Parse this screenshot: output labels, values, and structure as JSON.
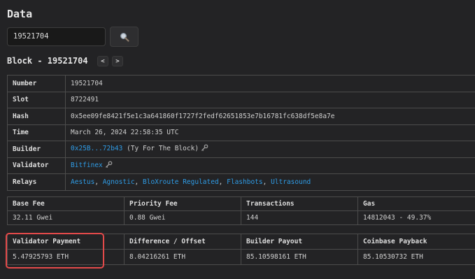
{
  "page": {
    "title": "Data"
  },
  "search": {
    "value": "19521704",
    "button_icon": "search-icon"
  },
  "block": {
    "heading": "Block - 19521704",
    "prev_label": "<",
    "next_label": ">"
  },
  "info": {
    "number_label": "Number",
    "number": "19521704",
    "slot_label": "Slot",
    "slot": "8722491",
    "hash_label": "Hash",
    "hash": "0x5ee09fe8421f5e1c3a641860f1727f2fedf62651853e7b16781fc638df5e8a7e",
    "time_label": "Time",
    "time": "March 26, 2024 22:58:35 UTC",
    "builder_label": "Builder",
    "builder_link": "0x25B...72b43",
    "builder_note": "(Ty For The Block)",
    "validator_label": "Validator",
    "validator_link": "Bitfinex",
    "relays_label": "Relays",
    "relays": [
      "Aestus",
      "Agnostic",
      "BloXroute Regulated",
      "Flashbots",
      "Ultrasound"
    ],
    "relay_sep": ", "
  },
  "stats": {
    "headers": [
      "Base Fee",
      "Priority Fee",
      "Transactions",
      "Gas"
    ],
    "values": [
      "32.11 Gwei",
      "0.88 Gwei",
      "144",
      "14812043 - 49.37%"
    ]
  },
  "payments": {
    "headers": [
      "Validator Payment",
      "Difference / Offset",
      "Builder Payout",
      "Coinbase Payback"
    ],
    "values": [
      "5.47925793 ETH",
      "8.04216261 ETH",
      "85.10598161 ETH",
      "85.10530732 ETH"
    ]
  },
  "colors": {
    "link": "#2f9ce6",
    "highlight": "#e34a4a",
    "background": "#232325"
  }
}
